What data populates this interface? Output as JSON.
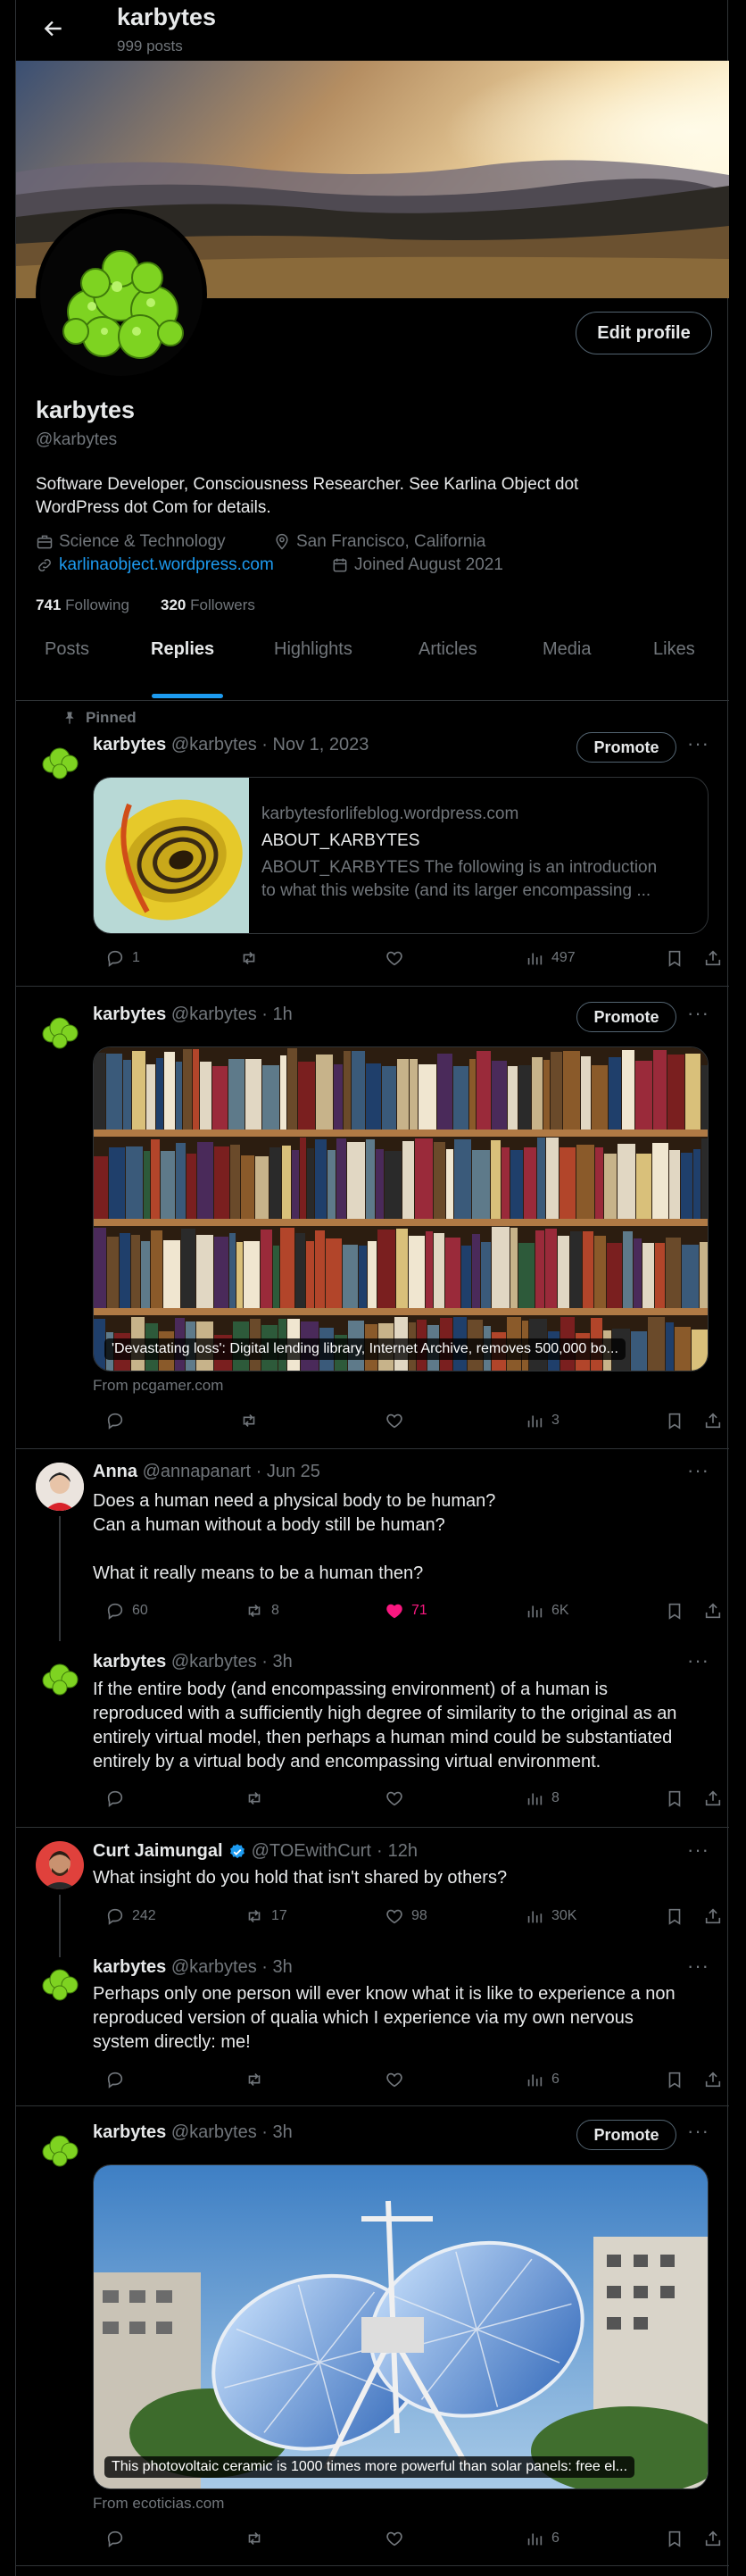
{
  "header": {
    "name": "karbytes",
    "posts_count": "999 posts"
  },
  "profile": {
    "name": "karbytes",
    "handle": "@karbytes",
    "edit_label": "Edit profile",
    "bio_line1": "Software Developer, Consciousness Researcher. See Karlina Object dot",
    "bio_line2": "WordPress dot Com for details.",
    "category": "Science & Technology",
    "location": "San Francisco, California",
    "website": "karlinaobject.wordpress.com",
    "joined": "Joined August 2021",
    "following_count": "741",
    "following_label": "Following",
    "followers_count": "320",
    "followers_label": "Followers"
  },
  "tabs": [
    "Posts",
    "Replies",
    "Highlights",
    "Articles",
    "Media",
    "Likes"
  ],
  "active_tab": "Replies",
  "posts": [
    {
      "pinned_label": "Pinned",
      "name": "karbytes",
      "handle": "@karbytes",
      "sep": "·",
      "time": "Nov 1, 2023",
      "promote": "Promote",
      "card": {
        "domain": "karbytesforlifeblog.wordpress.com",
        "title": "ABOUT_KARBYTES",
        "desc1": "ABOUT_KARBYTES The following is an introduction",
        "desc2": "to what this website (and its larger encompassing ..."
      },
      "replies": "1",
      "reposts": "",
      "likes": "",
      "views": "497"
    },
    {
      "name": "karbytes",
      "handle": "@karbytes",
      "sep": "·",
      "time": "1h",
      "promote": "Promote",
      "caption": "'Devastating loss': Digital lending library, Internet Archive, removes 500,000 bo...",
      "from": "From pcgamer.com",
      "replies": "",
      "reposts": "",
      "likes": "",
      "views": "3"
    },
    {
      "name": "Anna",
      "handle": "@annapanart",
      "sep": "·",
      "time": "Jun 25",
      "lines": [
        "Does a human need a physical body to be human?",
        "Can a human without a body still be human?",
        "",
        "What it really means to be a human then?"
      ],
      "replies": "60",
      "reposts": "8",
      "likes": "71",
      "views": "6K"
    },
    {
      "name": "karbytes",
      "handle": "@karbytes",
      "sep": "·",
      "time": "3h",
      "lines": [
        "If the entire body (and encompassing environment) of a human is",
        "reproduced with a sufficiently high degree of similarity to the original as an",
        "entirely virtual model, then perhaps a human mind could be substantiated",
        "entirely by a virtual body and encompassing virtual environment."
      ],
      "replies": "",
      "reposts": "",
      "likes": "",
      "views": "8"
    },
    {
      "name": "Curt Jaimungal",
      "handle": "@TOEwithCurt",
      "sep": "·",
      "time": "12h",
      "lines": [
        "What insight do you hold that isn't shared by others?"
      ],
      "replies": "242",
      "reposts": "17",
      "likes": "98",
      "views": "30K"
    },
    {
      "name": "karbytes",
      "handle": "@karbytes",
      "sep": "·",
      "time": "3h",
      "lines": [
        "Perhaps only one person will ever know what it is like to experience a non",
        "reproduced version of qualia which I experience via my own nervous",
        "system directly: me!"
      ],
      "replies": "",
      "reposts": "",
      "likes": "",
      "views": "6"
    },
    {
      "name": "karbytes",
      "handle": "@karbytes",
      "sep": "·",
      "time": "3h",
      "promote": "Promote",
      "caption": "This photovoltaic ceramic is 1000 times more powerful than solar panels: free el...",
      "from": "From ecoticias.com",
      "replies": "",
      "reposts": "",
      "likes": "",
      "views": "6"
    }
  ],
  "colors": {
    "accent": "#1d9bf0",
    "like_active": "#f91880",
    "verified": "#1d9bf0",
    "background": "#000000",
    "border": "#2f3336"
  },
  "icons": [
    "back-arrow-icon",
    "briefcase-icon",
    "location-pin-icon",
    "link-icon",
    "calendar-icon",
    "pin-icon",
    "reply-icon",
    "repost-icon",
    "like-icon",
    "views-icon",
    "bookmark-icon",
    "share-icon",
    "more-icon",
    "verified-badge-icon"
  ]
}
